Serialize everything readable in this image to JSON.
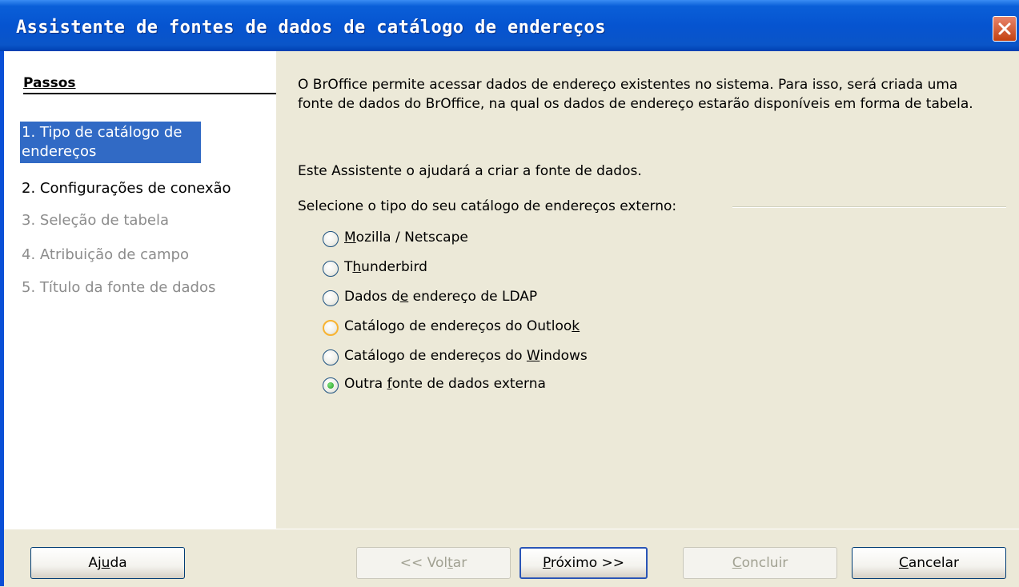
{
  "window": {
    "title": "Assistente de fontes de dados de catálogo de endereços"
  },
  "sidebar": {
    "heading": "Passos",
    "steps": [
      {
        "label": "1. Tipo de catálogo de endereços",
        "state": "active"
      },
      {
        "label": "2. Configurações de conexão",
        "state": "enabled"
      },
      {
        "label": "3. Seleção de tabela",
        "state": "disabled"
      },
      {
        "label": "4. Atribuição de campo",
        "state": "disabled"
      },
      {
        "label": "5. Título da fonte de dados",
        "state": "disabled"
      }
    ]
  },
  "content": {
    "intro": "O BrOffice permite acessar dados de endereço existentes no sistema. Para isso, será criada uma fonte de dados do BrOffice, na qual os dados de endereço estarão disponíveis em forma de tabela.",
    "assistant_note": "Este Assistente o ajudará a criar a fonte de dados.",
    "group_label": "Selecione o tipo do seu catálogo de endereços externo:",
    "options": [
      {
        "label": "Mozilla / Netscape",
        "accel": "M",
        "selected": false
      },
      {
        "label": "Thunderbird",
        "accel": "h",
        "selected": false
      },
      {
        "label": "Dados de endereço de LDAP",
        "accel": "e",
        "selected": false
      },
      {
        "label": "Catálogo de endereços do Outlook",
        "accel": "k",
        "selected": false
      },
      {
        "label": "Catálogo de endereços do Windows",
        "accel": "W",
        "selected": false
      },
      {
        "label": "Outra fonte de dados externa",
        "accel": "f",
        "selected": true
      }
    ]
  },
  "footer": {
    "help_label": "Ajuda",
    "back_label": "<< Voltar",
    "next_label": "Próximo >>",
    "finish_label": "Concluir",
    "cancel_label": "Cancelar"
  },
  "colors": {
    "titlebar": "#0654d0",
    "selection": "#316ac5",
    "dialog_bg": "#ece9d8",
    "disabled_text": "#8c8c8c",
    "radio_selected_dot": "#21a121",
    "radio_hover_ring": "#f8b331"
  },
  "icons": {
    "close": "close-icon"
  }
}
